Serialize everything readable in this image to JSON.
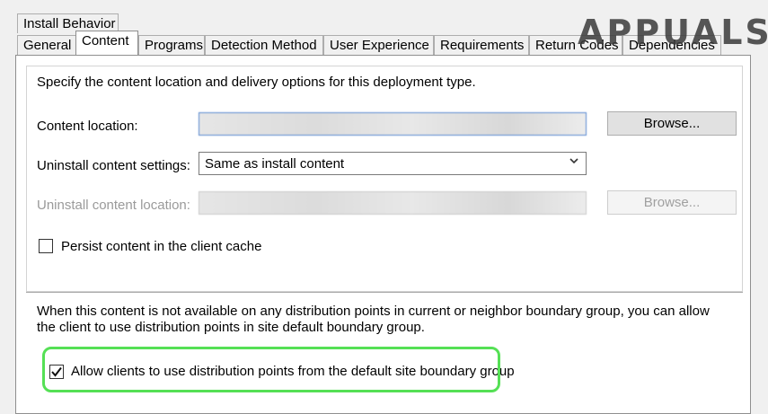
{
  "tabs_row1": [
    {
      "label": "Install Behavior"
    }
  ],
  "tabs_row2": [
    {
      "label": "General"
    },
    {
      "label": "Content"
    },
    {
      "label": "Programs"
    },
    {
      "label": "Detection Method"
    },
    {
      "label": "User Experience"
    },
    {
      "label": "Requirements"
    },
    {
      "label": "Return Codes"
    },
    {
      "label": "Dependencies"
    }
  ],
  "active_tab": "Content",
  "content": {
    "intro": "Specify the content location and delivery options for this deployment type.",
    "content_location_label": "Content location:",
    "content_location_value": "",
    "browse_label": "Browse...",
    "uninstall_settings_label": "Uninstall content settings:",
    "uninstall_settings_value": "Same as install content",
    "uninstall_location_label": "Uninstall content location:",
    "uninstall_browse_label": "Browse...",
    "persist_label": "Persist content in the client cache",
    "persist_checked": false,
    "distribution_text": "When this content is not available on any distribution points in current or neighbor boundary group, you can allow the client to use distribution points in site default boundary group.",
    "allow_label": "Allow clients to use distribution points from the default site boundary group",
    "allow_checked": true
  },
  "logo": {
    "text": "APPUALS"
  },
  "colors": {
    "highlight": "#55e055",
    "panel": "#ffffff",
    "background": "#f0f0f0"
  }
}
